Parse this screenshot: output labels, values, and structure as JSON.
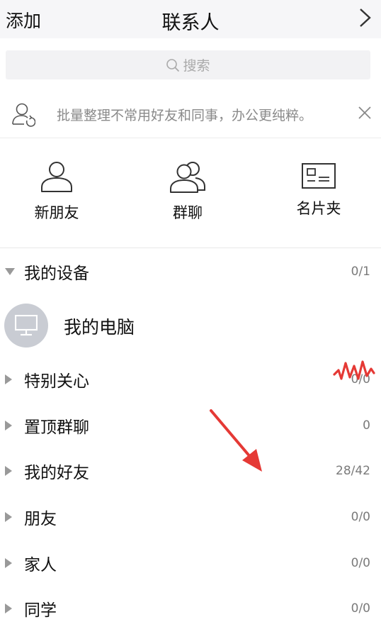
{
  "header": {
    "add_label": "添加",
    "title": "联系人"
  },
  "search": {
    "placeholder": "搜索"
  },
  "notice": {
    "text": "批量整理不常用好友和同事，办公更纯粹。"
  },
  "quick_actions": [
    {
      "label": "新朋友",
      "icon": "person-icon"
    },
    {
      "label": "群聊",
      "icon": "group-icon"
    },
    {
      "label": "名片夹",
      "icon": "business-card-icon"
    }
  ],
  "groups": [
    {
      "name": "我的设备",
      "count": "0/1",
      "expanded": true
    },
    {
      "name": "特别关心",
      "count": "0/0",
      "expanded": false
    },
    {
      "name": "置顶群聊",
      "count": "0",
      "expanded": false
    },
    {
      "name": "我的好友",
      "count": "28/42",
      "expanded": false
    },
    {
      "name": "朋友",
      "count": "0/0",
      "expanded": false
    },
    {
      "name": "家人",
      "count": "0/0",
      "expanded": false
    },
    {
      "name": "同学",
      "count": "0/0",
      "expanded": false
    }
  ],
  "device": {
    "name": "我的电脑",
    "icon": "monitor-icon"
  },
  "colors": {
    "accent_red": "#e53935",
    "header_bg": "#f6f6f8",
    "search_bg": "#f2f2f4",
    "avatar_bg": "#c9ccd3"
  }
}
